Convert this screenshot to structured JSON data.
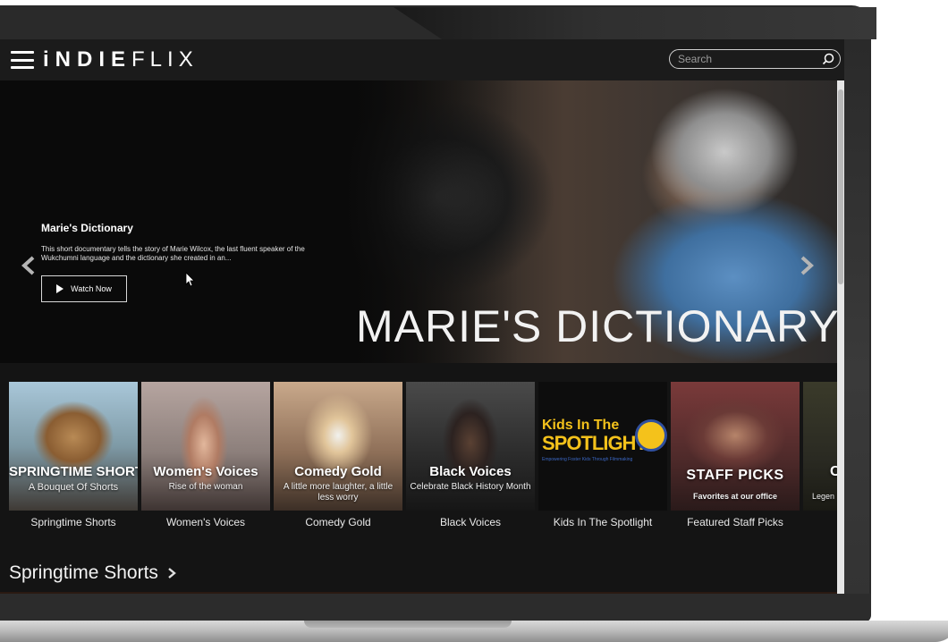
{
  "app": {
    "logo_bold": "iNDIE",
    "logo_thin": "FLIX"
  },
  "header": {
    "search_placeholder": "Search"
  },
  "hero": {
    "title": "Marie's Dictionary",
    "description": "This short documentary tells the story of Marie Wilcox, the last fluent speaker of the Wukchumni language and the dictionary she created in an...",
    "watch_button_label": "Watch Now",
    "art_title": "MARIE'S DICTIONARY",
    "slides_count": 4,
    "active_slide": 3
  },
  "collections": [
    {
      "label": "Springtime Shorts",
      "thumb_title": "SPRINGTIME SHORTS",
      "thumb_subtitle": "A Bouquet Of Shorts"
    },
    {
      "label": "Women's Voices",
      "thumb_title": "Women's Voices",
      "thumb_subtitle": "Rise of the woman"
    },
    {
      "label": "Comedy Gold",
      "thumb_title": "Comedy Gold",
      "thumb_subtitle": "A little more laughter, a little less worry"
    },
    {
      "label": "Black Voices",
      "thumb_title": "Black Voices",
      "thumb_subtitle": "Celebrate Black History Month"
    },
    {
      "label": "Kids In The Spotlight",
      "thumb_title": "Kids In The",
      "thumb_subtitle": "SPOTLIGHT",
      "thumb_tagline": "Empowering Foster Kids Through Filmmaking"
    },
    {
      "label": "Featured Staff Picks",
      "thumb_title": "STAFF PICKS",
      "thumb_subtitle": "Favorites at our office"
    },
    {
      "label": "",
      "thumb_title": "C",
      "thumb_subtitle": "Legen"
    }
  ],
  "section": {
    "title": "Springtime Shorts"
  },
  "colors": {
    "background": "#141414",
    "topbar": "#1b1b1b",
    "kids_yellow": "#f4c21b",
    "kids_blue": "#2f4f9f"
  }
}
